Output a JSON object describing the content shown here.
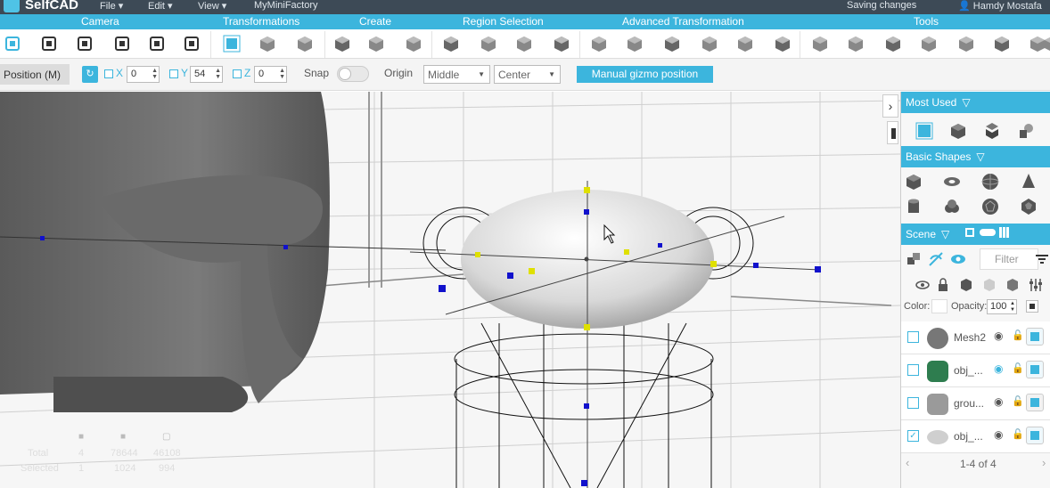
{
  "app": {
    "logo_text": "SelfCAD"
  },
  "menu": [
    "File ▾",
    "Edit ▾",
    "View ▾",
    "MyMiniFactory"
  ],
  "status": {
    "saving": "Saving changes",
    "user": "Hamdy Mostafa"
  },
  "categories": [
    "Camera",
    "Transformations",
    "Create",
    "Region Selection",
    "Advanced Transformation",
    "Tools"
  ],
  "tools": {
    "icons": [
      "camera-tool-icon",
      "select-icon",
      "move-icon",
      "rotate-icon",
      "scale-icon",
      "stack-icon",
      "gizmo-icon",
      "cube-rotate-icon",
      "cube-alt-icon",
      "extrude-icon",
      "hat-icon",
      "cube-solid-icon",
      "face-select-icon",
      "volume-select-icon",
      "edge-select-icon",
      "vertex-select-icon",
      "mesh-icon",
      "wire-cube-icon",
      "cube-twist-icon",
      "cone-icon",
      "hourglass-icon",
      "slab-icon",
      "box-icon",
      "cube-tool-icon",
      "wire-box-icon",
      "sphere-icon",
      "poly-icon",
      "grid-cube-icon",
      "check-tool-icon",
      "more-icon"
    ]
  },
  "props": {
    "position_label": "Position (M)",
    "refresh_symbol": "↻",
    "x_label": "X",
    "x_value": "0",
    "y_label": "Y",
    "y_value": "54",
    "z_label": "Z",
    "z_value": "0",
    "snap_label": "Snap",
    "origin_label": "Origin",
    "origin_value": "Middle",
    "center_value": "Center",
    "gizmo_button": "Manual gizmo position"
  },
  "viewport": {
    "collapse_symbol": "›",
    "stats": {
      "total_label": "Total",
      "selected_label": "Selected",
      "total": [
        "4",
        "78644",
        "46108"
      ],
      "selected": [
        "1",
        "1024",
        "994"
      ]
    }
  },
  "panel": {
    "most_used": "Most Used",
    "basic_shapes": "Basic Shapes",
    "scene": "Scene",
    "filter_placeholder": "Filter",
    "color_label": "Color:",
    "opacity_label": "Opacity:",
    "opacity_value": "100",
    "objects": [
      {
        "name": "Mesh2",
        "checked": "",
        "thumb": "#777777"
      },
      {
        "name": "obj_...",
        "checked": "",
        "thumb": "#2e7d4f"
      },
      {
        "name": "grou...",
        "checked": "",
        "thumb": "#9a9a9a"
      },
      {
        "name": "obj_...",
        "checked": "✓",
        "thumb": "#cfcfcf"
      }
    ],
    "pager": "1-4 of 4"
  },
  "colors": {
    "accent": "#3cb5dd",
    "topbar": "#3d4a56"
  }
}
